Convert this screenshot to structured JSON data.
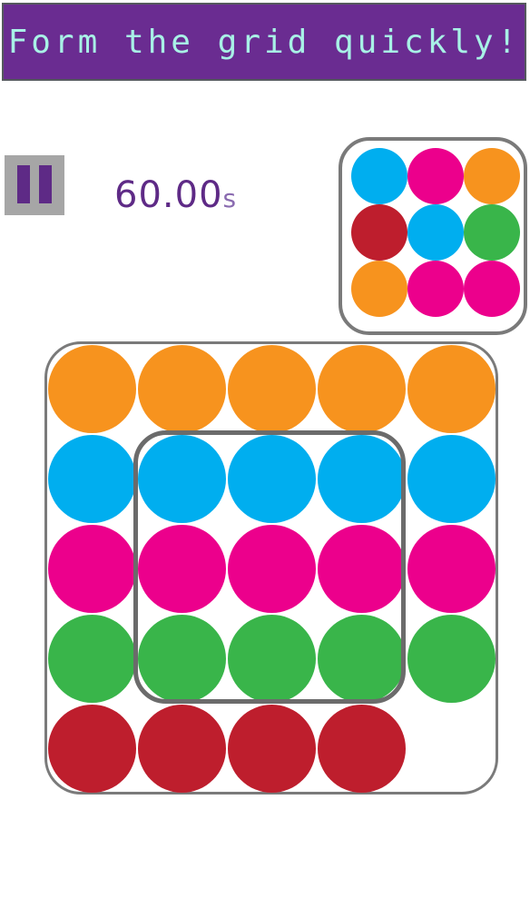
{
  "header": {
    "title": "Form the grid quickly!"
  },
  "controls": {
    "pause_icon": "pause-icon"
  },
  "timer": {
    "value": "60.00",
    "unit": "s"
  },
  "colors": {
    "orange": "#f7931e",
    "blue": "#00aeef",
    "pink": "#ec008c",
    "green": "#39b54a",
    "red": "#be1e2d",
    "banner": "#6a2c91",
    "banner_text": "#a8f1e6",
    "accent": "#5e2a86"
  },
  "target_pattern": [
    [
      "blue",
      "pink",
      "orange"
    ],
    [
      "red",
      "blue",
      "green"
    ],
    [
      "orange",
      "pink",
      "pink"
    ]
  ],
  "board": [
    [
      "orange",
      "orange",
      "orange",
      "orange",
      "orange"
    ],
    [
      "blue",
      "blue",
      "blue",
      "blue",
      "blue"
    ],
    [
      "pink",
      "pink",
      "pink",
      "pink",
      "pink"
    ],
    [
      "green",
      "green",
      "green",
      "green",
      "green"
    ],
    [
      "red",
      "red",
      "red",
      "red",
      null
    ]
  ]
}
